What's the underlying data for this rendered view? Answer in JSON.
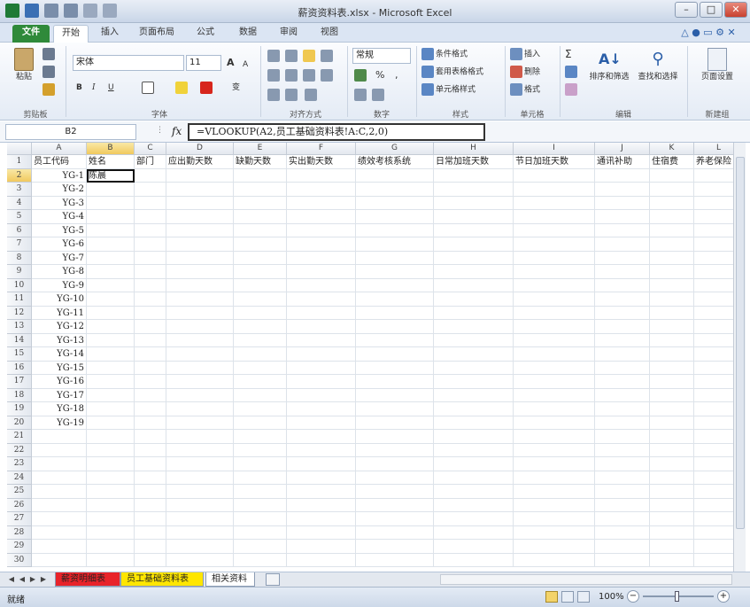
{
  "window": {
    "title": "薪资资料表.xlsx - Microsoft Excel",
    "minimize": "–",
    "maximize": "□",
    "close": "✕"
  },
  "tabs": [
    "文件",
    "开始",
    "插入",
    "页面布局",
    "公式",
    "数据",
    "审阅",
    "视图"
  ],
  "ribbon": {
    "clipboard": {
      "paste": "粘贴",
      "label": "剪贴板"
    },
    "font": {
      "name": "宋体",
      "size": "11",
      "grow": "A",
      "shrink": "A",
      "bold": "B",
      "italic": "I",
      "underline": "U",
      "phonetic": "变",
      "label": "字体"
    },
    "alignment": {
      "label": "对齐方式"
    },
    "number": {
      "format": "常规",
      "label": "数字"
    },
    "styles": {
      "conditional": "条件格式",
      "table": "套用表格格式",
      "cell": "单元格样式",
      "label": "样式"
    },
    "cells": {
      "insert": "插入",
      "delete": "删除",
      "format": "格式",
      "label": "单元格"
    },
    "editing": {
      "sigma": "Σ",
      "sort": "排序和筛选",
      "find": "查找和选择",
      "label": "编辑"
    },
    "newgroup": {
      "pagesetup": "页面设置",
      "label": "新建组"
    }
  },
  "formula_bar": {
    "namebox": "B2",
    "fx": "fx",
    "formula": "=VLOOKUP(A2,员工基础资料表!A:C,2,0)"
  },
  "columns": [
    "A",
    "B",
    "C",
    "D",
    "E",
    "F",
    "G",
    "H",
    "I",
    "J",
    "K",
    "L"
  ],
  "header_row": [
    "员工代码",
    "姓名",
    "部门",
    "应出勤天数",
    "缺勤天数",
    "实出勤天数",
    "绩效考核系统",
    "日常加班天数",
    "节日加班天数",
    "通讯补助",
    "住宿费",
    "养老保险"
  ],
  "employee_codes": [
    "YG-1",
    "YG-2",
    "YG-3",
    "YG-4",
    "YG-5",
    "YG-6",
    "YG-7",
    "YG-8",
    "YG-9",
    "YG-10",
    "YG-11",
    "YG-12",
    "YG-13",
    "YG-14",
    "YG-15",
    "YG-16",
    "YG-17",
    "YG-18",
    "YG-19"
  ],
  "selected_cell_value": "陈晨",
  "row_numbers": [
    "1",
    "2",
    "3",
    "4",
    "5",
    "6",
    "7",
    "8",
    "9",
    "10",
    "11",
    "12",
    "13",
    "14",
    "15",
    "16",
    "17",
    "18",
    "19",
    "20",
    "21",
    "22",
    "23",
    "24",
    "25",
    "26",
    "27",
    "28",
    "29",
    "30"
  ],
  "sheets": [
    {
      "name": "薪资明细表",
      "color": "#e8232a"
    },
    {
      "name": "员工基础资料表",
      "color": "#ffe600"
    },
    {
      "name": "相关资料",
      "color": "#ffffff"
    }
  ],
  "status": {
    "ready": "就绪",
    "zoom": "100%",
    "minus": "−",
    "plus": "+"
  },
  "colors": {
    "file_tab": "#2f8a3a",
    "selection_header": "#f1c95e"
  }
}
